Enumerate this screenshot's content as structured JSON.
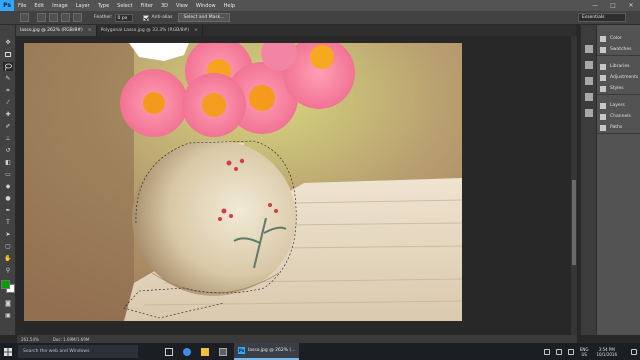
{
  "app": {
    "logo_text": "Ps"
  },
  "menu": [
    "File",
    "Edit",
    "Image",
    "Layer",
    "Type",
    "Select",
    "Filter",
    "3D",
    "View",
    "Window",
    "Help"
  ],
  "window_controls": {
    "minimize": "—",
    "maximize": "□",
    "close": "✕"
  },
  "options_bar": {
    "feather_label": "Feather:",
    "feather_value": "0 px",
    "anti_alias_label": "Anti-alias",
    "anti_alias_checked": true,
    "select_mask_button": "Select and Mask...",
    "workspace": "Essentials"
  },
  "tabs": [
    {
      "label": "lasso.jpg @ 262% (RGB/8#)",
      "close": "×",
      "active": true
    },
    {
      "label": "Polygonal Lasso.jpg @ 33.3% (RGB/8#)",
      "close": "×",
      "active": false
    }
  ],
  "status": {
    "zoom": "261.54%",
    "doc": "Doc: 1.69M/1.69M"
  },
  "panels": {
    "group1": [
      "Color",
      "Swatches"
    ],
    "group2": [
      "Libraries",
      "Adjustments",
      "Styles"
    ],
    "group3": [
      "Layers",
      "Channels",
      "Paths"
    ]
  },
  "taskbar": {
    "search_placeholder": "Search the web and Windows",
    "ps_task_label": "lasso.jpg @ 262% (...",
    "ps_icon_text": "Ps",
    "lang_line1": "ENG",
    "lang_line2": "US",
    "time": "3:54 PM",
    "date": "10/1/2016"
  },
  "colors": {
    "foreground": "#00a000",
    "background": "#ffffff",
    "accent": "#31a8ff",
    "taskbar_highlight": "#76b9ed"
  }
}
